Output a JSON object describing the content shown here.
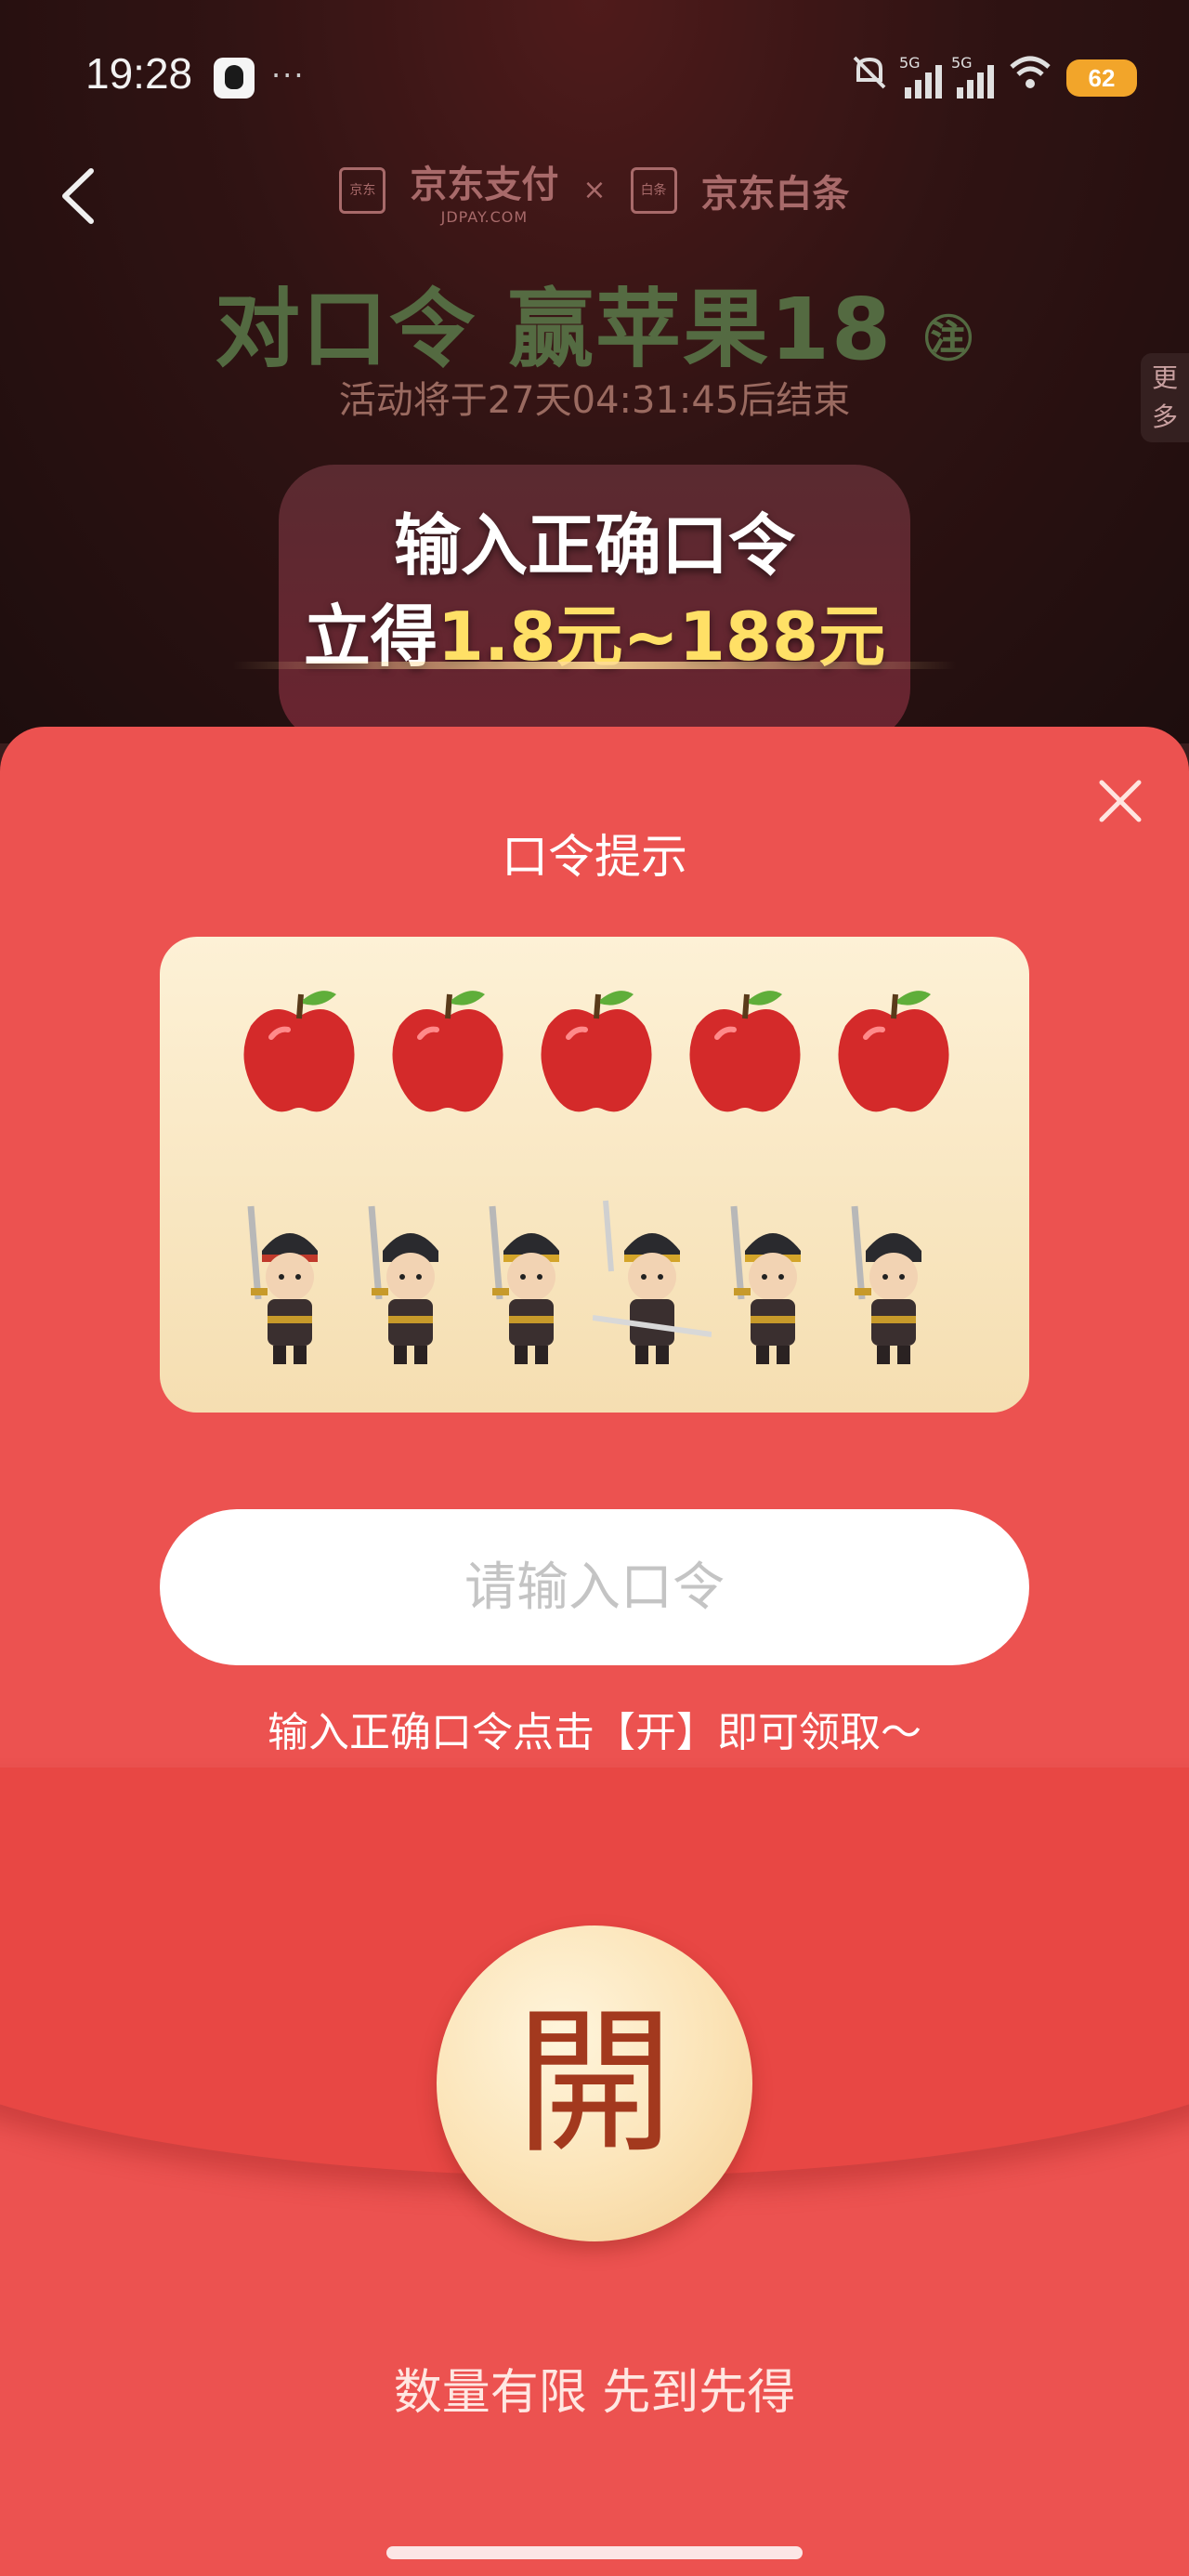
{
  "status_bar": {
    "time": "19:28",
    "dots": "···",
    "net1": "5G",
    "net2": "5G",
    "battery": "62"
  },
  "header": {
    "brand_left": "京东支付",
    "brand_left_sub": "JDPAY.COM",
    "brand_left_logo": "京东",
    "brand_x": "×",
    "brand_right": "京东白条",
    "brand_right_logo": "白条",
    "title": "对口令 赢苹果18",
    "title_badge": "㊟",
    "countdown": "活动将于27天04:31:45后结束",
    "more_tab": "更多"
  },
  "promo": {
    "line1": "输入正确口令",
    "line2_prefix": "立得",
    "line2_highlight": "1.8元~188元"
  },
  "sheet": {
    "title": "口令提示",
    "hint": {
      "apple_count": 5,
      "warrior_count": 6
    },
    "input_placeholder": "请输入口令",
    "instruction": "输入正确口令点击【开】即可领取～",
    "open_label": "開",
    "footer": "数量有限 先到先得"
  },
  "colors": {
    "sheet_bg": "#ec5250",
    "card_bg": "#fdf1d6",
    "open_text": "#a3391e",
    "promo_highlight": "#ffe066"
  }
}
